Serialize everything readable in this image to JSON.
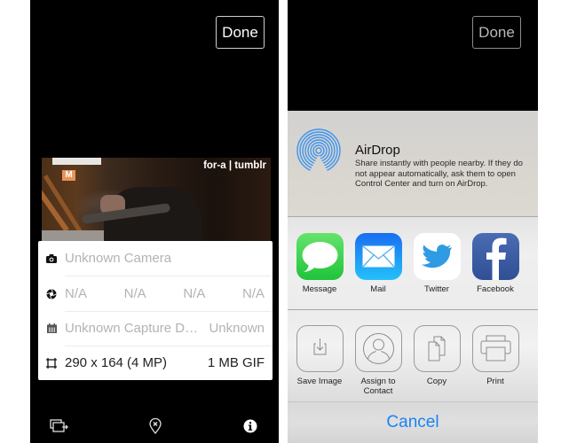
{
  "left_screen": {
    "done_label": "Done",
    "gif": {
      "watermark": "for-a | tumblr",
      "sign_letter": "M"
    },
    "info": {
      "camera": {
        "icon": "camera-icon",
        "text": "Unknown Camera"
      },
      "exposure": {
        "icon": "aperture-icon",
        "values": [
          "N/A",
          "N/A",
          "N/A",
          "N/A"
        ]
      },
      "capture_date": {
        "icon": "calendar-icon",
        "text": "Unknown Capture D…",
        "right": "Unknown"
      },
      "dimensions": {
        "icon": "crop-icon",
        "text": "290 x 164 (4 MP)",
        "right": "1 MB GIF"
      }
    },
    "toolbar": [
      {
        "icon": "share-export-icon"
      },
      {
        "icon": "location-remove-icon"
      },
      {
        "icon": "info-icon"
      }
    ]
  },
  "right_screen": {
    "done_label": "Done",
    "airdrop": {
      "icon": "airdrop-icon",
      "title": "AirDrop",
      "description": "Share instantly with people nearby. If they do not appear automatically, ask them to open Control Center and turn on AirDrop."
    },
    "share_apps": [
      {
        "label": "Message",
        "icon": "message-icon",
        "color": "#3fd64f"
      },
      {
        "label": "Mail",
        "icon": "mail-icon",
        "color": "#1e8cf5"
      },
      {
        "label": "Twitter",
        "icon": "twitter-icon",
        "color": "#2f9ee3"
      },
      {
        "label": "Facebook",
        "icon": "facebook-icon",
        "color": "#3b5a9f"
      }
    ],
    "actions": [
      {
        "label": "Save Image",
        "icon": "save-image-icon"
      },
      {
        "label": "Assign to\nContact",
        "icon": "contact-icon"
      },
      {
        "label": "Copy",
        "icon": "copy-icon"
      },
      {
        "label": "Print",
        "icon": "print-icon"
      }
    ],
    "cancel_label": "Cancel",
    "accent_color": "#1a82f7"
  }
}
